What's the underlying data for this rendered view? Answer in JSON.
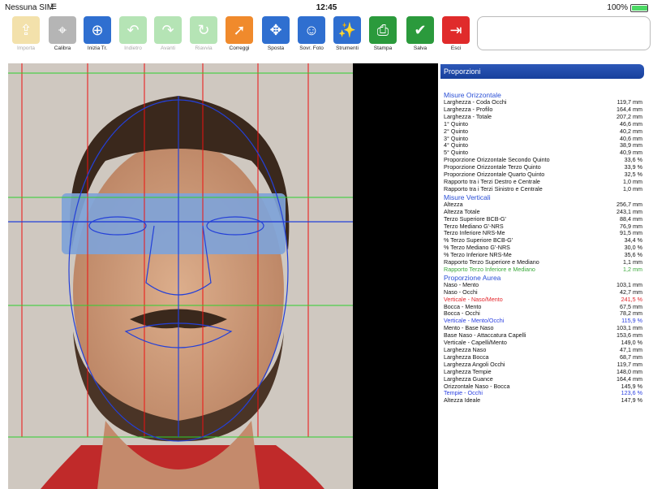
{
  "status": {
    "carrier": "Nessuna SIM",
    "time": "12:45",
    "battery": "100%",
    "battery_level": 1.0
  },
  "toolbar": [
    {
      "label": "Importa",
      "icon": "import-folder-icon",
      "color": "#e8c55a",
      "disabled": true
    },
    {
      "label": "Calibra",
      "icon": "calibrate-ruler-icon",
      "color": "#b5b5b5",
      "disabled": false
    },
    {
      "label": "Inizia Tr.",
      "icon": "start-trace-icon",
      "color": "#2f6fd0",
      "disabled": false
    },
    {
      "label": "Indietro",
      "icon": "undo-arrow-icon",
      "color": "#6ecb6e",
      "disabled": true
    },
    {
      "label": "Avanti",
      "icon": "redo-arrow-icon",
      "color": "#6ecb6e",
      "disabled": true
    },
    {
      "label": "Riavvia",
      "icon": "restart-icon",
      "color": "#6ecb6e",
      "disabled": true
    },
    {
      "label": "Correggi",
      "icon": "correct-pointer-icon",
      "color": "#f08a2c",
      "disabled": false
    },
    {
      "label": "Sposta",
      "icon": "move-arrows-icon",
      "color": "#2f6fd0",
      "disabled": false
    },
    {
      "label": "Sovr. Foto",
      "icon": "overlay-photo-icon",
      "color": "#2f6fd0",
      "disabled": false
    },
    {
      "label": "Strumenti",
      "icon": "tools-wand-icon",
      "color": "#2f6fd0",
      "disabled": false
    },
    {
      "label": "Stampa",
      "icon": "printer-icon",
      "color": "#2b9a3c",
      "disabled": false
    },
    {
      "label": "Salva",
      "icon": "save-check-icon",
      "color": "#2b9a3c",
      "disabled": false
    },
    {
      "label": "Esci",
      "icon": "exit-icon",
      "color": "#e02b2b",
      "disabled": false
    }
  ],
  "panel": {
    "title": "Proporzioni"
  },
  "sections": [
    {
      "title": "Misure Orizzontale",
      "rows": [
        {
          "label": "Larghezza - Coda Occhi",
          "value": "119,7 mm",
          "color": ""
        },
        {
          "label": "Larghezza - Profilo",
          "value": "164,4 mm",
          "color": ""
        },
        {
          "label": "Larghezza - Totale",
          "value": "207,2 mm",
          "color": ""
        },
        {
          "label": "1° Quinto",
          "value": "46,6 mm",
          "color": ""
        },
        {
          "label": "2° Quinto",
          "value": "40,2 mm",
          "color": ""
        },
        {
          "label": "3° Quinto",
          "value": "40,6 mm",
          "color": ""
        },
        {
          "label": "4° Quinto",
          "value": "38,9 mm",
          "color": ""
        },
        {
          "label": "5° Quinto",
          "value": "40,9 mm",
          "color": ""
        },
        {
          "label": "Proporzione Orizzontale Secondo Quinto",
          "value": "33,6 %",
          "color": ""
        },
        {
          "label": "Proporzione Orizzontale Terzo Quinto",
          "value": "33,9 %",
          "color": ""
        },
        {
          "label": "Proporzione Orizzontale Quarto Quinto",
          "value": "32,5 %",
          "color": ""
        },
        {
          "label": "Rapporto tra i Terzi Destro e Centrale",
          "value": "1,0 mm",
          "color": ""
        },
        {
          "label": "Rapporto tra i Terzi Sinistro e Centrale",
          "value": "1,0 mm",
          "color": ""
        }
      ]
    },
    {
      "title": "Misure Verticali",
      "rows": [
        {
          "label": "Altezza",
          "value": "256,7 mm",
          "color": ""
        },
        {
          "label": "Altezza Totale",
          "value": "243,1 mm",
          "color": ""
        },
        {
          "label": "Terzo Superiore BCB-G'",
          "value": "88,4 mm",
          "color": ""
        },
        {
          "label": "Terzo Mediano G'-NRS",
          "value": "76,9 mm",
          "color": ""
        },
        {
          "label": "Terzo Inferiore NRS-Me",
          "value": "91,5 mm",
          "color": ""
        },
        {
          "label": "% Terzo Superiore BCB-G'",
          "value": "34,4 %",
          "color": ""
        },
        {
          "label": "% Terzo Mediano G'-NRS",
          "value": "30,0 %",
          "color": ""
        },
        {
          "label": "% Terzo Inferiore NRS-Me",
          "value": "35,6 %",
          "color": ""
        },
        {
          "label": "Rapporto Terzo Superiore e Mediano",
          "value": "1,1 mm",
          "color": ""
        },
        {
          "label": "Rapporto Terzo Inferiore e Mediano",
          "value": "1,2 mm",
          "color": "green"
        }
      ]
    },
    {
      "title": "Proporzione Aurea",
      "rows": [
        {
          "label": "Naso - Mento",
          "value": "103,1 mm",
          "color": ""
        },
        {
          "label": "Naso - Occhi",
          "value": "42,7 mm",
          "color": ""
        },
        {
          "label": "Verticale - Naso/Mento",
          "value": "241,5 %",
          "color": "red"
        },
        {
          "label": "Bocca - Mento",
          "value": "67,5 mm",
          "color": ""
        },
        {
          "label": "Bocca - Occhi",
          "value": "78,2 mm",
          "color": ""
        },
        {
          "label": "Verticale - Mento/Occhi",
          "value": "115,9 %",
          "color": "blue"
        },
        {
          "label": "Mento - Base Naso",
          "value": "103,1 mm",
          "color": ""
        },
        {
          "label": "Base Naso - Attaccatura Capelli",
          "value": "153,6 mm",
          "color": ""
        },
        {
          "label": "Verticale - Capelli/Mento",
          "value": "149,0 %",
          "color": ""
        },
        {
          "label": "Larghezza Naso",
          "value": "47,1 mm",
          "color": ""
        },
        {
          "label": "Larghezza Bocca",
          "value": "68,7 mm",
          "color": ""
        },
        {
          "label": "Larghezza Angoli Occhi",
          "value": "119,7 mm",
          "color": ""
        },
        {
          "label": "Larghezza Tempie",
          "value": "148,0 mm",
          "color": ""
        },
        {
          "label": "Larghezza Guance",
          "value": "164,4 mm",
          "color": ""
        },
        {
          "label": "Orizzontale Naso - Bocca",
          "value": "145,9 %",
          "color": ""
        },
        {
          "label": "Tempie - Occhi",
          "value": "123,6 %",
          "color": "blue"
        },
        {
          "label": "Altezza Ideale",
          "value": "147,9 %",
          "color": ""
        }
      ]
    }
  ]
}
